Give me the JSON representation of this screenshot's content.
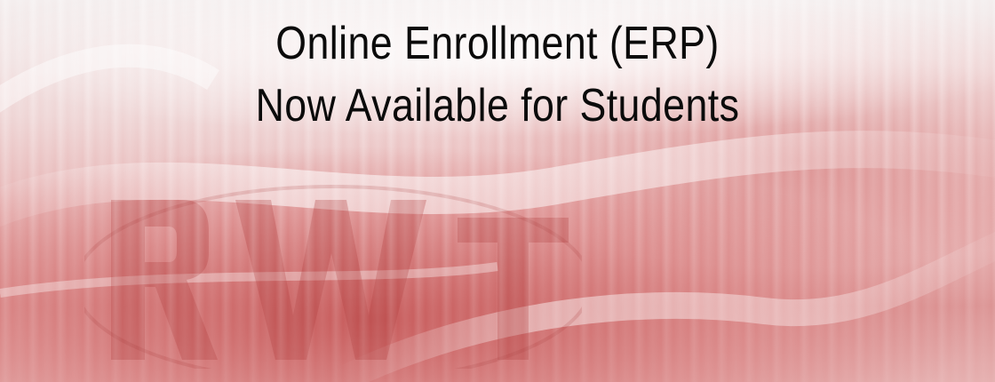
{
  "banner": {
    "line1": "Online Enrollment (ERP)",
    "line2": "Now Available for Students",
    "logo_icon": "university-crest-watermark",
    "colors": {
      "text": "#0b0b0b",
      "accent": "#c45252",
      "background": "#f4eeee"
    }
  }
}
